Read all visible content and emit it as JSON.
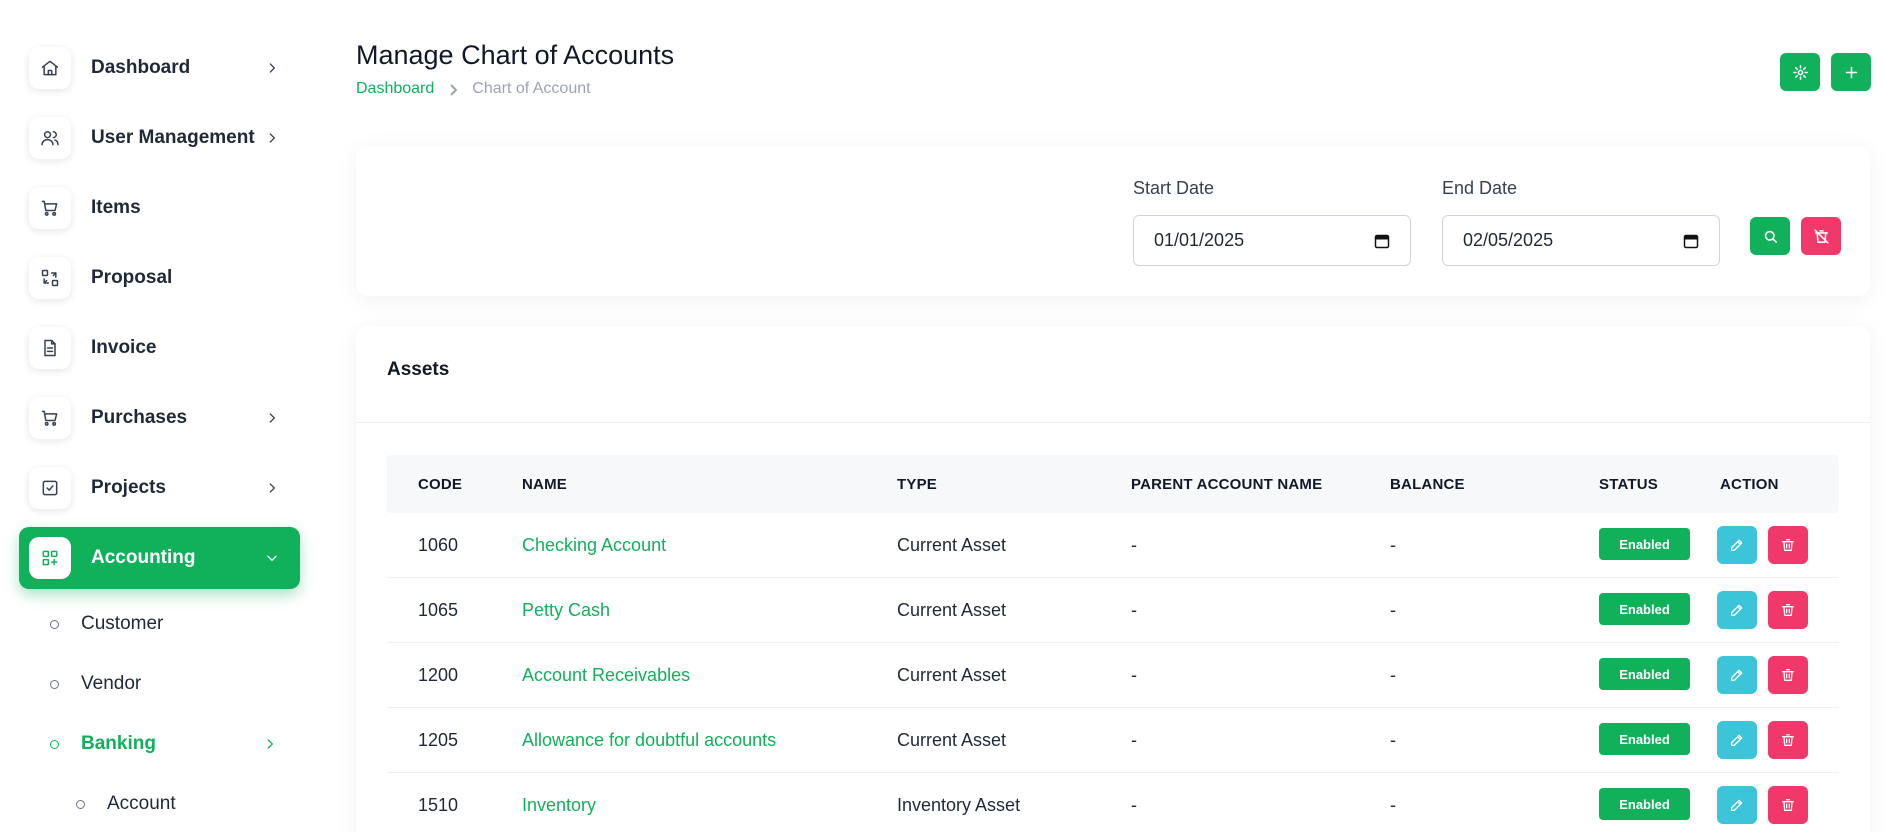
{
  "colors": {
    "accent": "#11b05b",
    "danger": "#f1386a",
    "edit": "#3cc4d8"
  },
  "sidebar": {
    "items": [
      {
        "label": "Dashboard",
        "icon": "home-icon",
        "has_chevron": true
      },
      {
        "label": "User Management",
        "icon": "users-icon",
        "has_chevron": true
      },
      {
        "label": "Items",
        "icon": "cart-icon",
        "has_chevron": false
      },
      {
        "label": "Proposal",
        "icon": "exchange-icon",
        "has_chevron": false
      },
      {
        "label": "Invoice",
        "icon": "file-icon",
        "has_chevron": false
      },
      {
        "label": "Purchases",
        "icon": "cart-icon",
        "has_chevron": true
      },
      {
        "label": "Projects",
        "icon": "checkbox-icon",
        "has_chevron": true
      },
      {
        "label": "Accounting",
        "icon": "apps-icon",
        "has_chevron": true,
        "active": true
      }
    ],
    "sub_items": [
      {
        "label": "Customer"
      },
      {
        "label": "Vendor"
      },
      {
        "label": "Banking",
        "active": true
      },
      {
        "label": "Account"
      }
    ]
  },
  "header": {
    "title": "Manage Chart of Accounts",
    "breadcrumb": [
      "Dashboard",
      "Chart of Account"
    ],
    "buttons": [
      "gear-icon",
      "plus-icon"
    ]
  },
  "filter": {
    "start_label": "Start Date",
    "start_value": "01/01/2025",
    "end_label": "End Date",
    "end_value": "02/05/2025"
  },
  "table": {
    "section_title": "Assets",
    "columns": [
      "CODE",
      "NAME",
      "TYPE",
      "PARENT ACCOUNT NAME",
      "BALANCE",
      "STATUS",
      "ACTION"
    ],
    "rows": [
      {
        "code": "1060",
        "name": "Checking Account",
        "type": "Current Asset",
        "parent": "-",
        "balance": "-",
        "status": "Enabled"
      },
      {
        "code": "1065",
        "name": "Petty Cash",
        "type": "Current Asset",
        "parent": "-",
        "balance": "-",
        "status": "Enabled"
      },
      {
        "code": "1200",
        "name": "Account Receivables",
        "type": "Current Asset",
        "parent": "-",
        "balance": "-",
        "status": "Enabled"
      },
      {
        "code": "1205",
        "name": "Allowance for doubtful accounts",
        "type": "Current Asset",
        "parent": "-",
        "balance": "-",
        "status": "Enabled"
      },
      {
        "code": "1510",
        "name": "Inventory",
        "type": "Inventory Asset",
        "parent": "-",
        "balance": "-",
        "status": "Enabled"
      }
    ]
  }
}
